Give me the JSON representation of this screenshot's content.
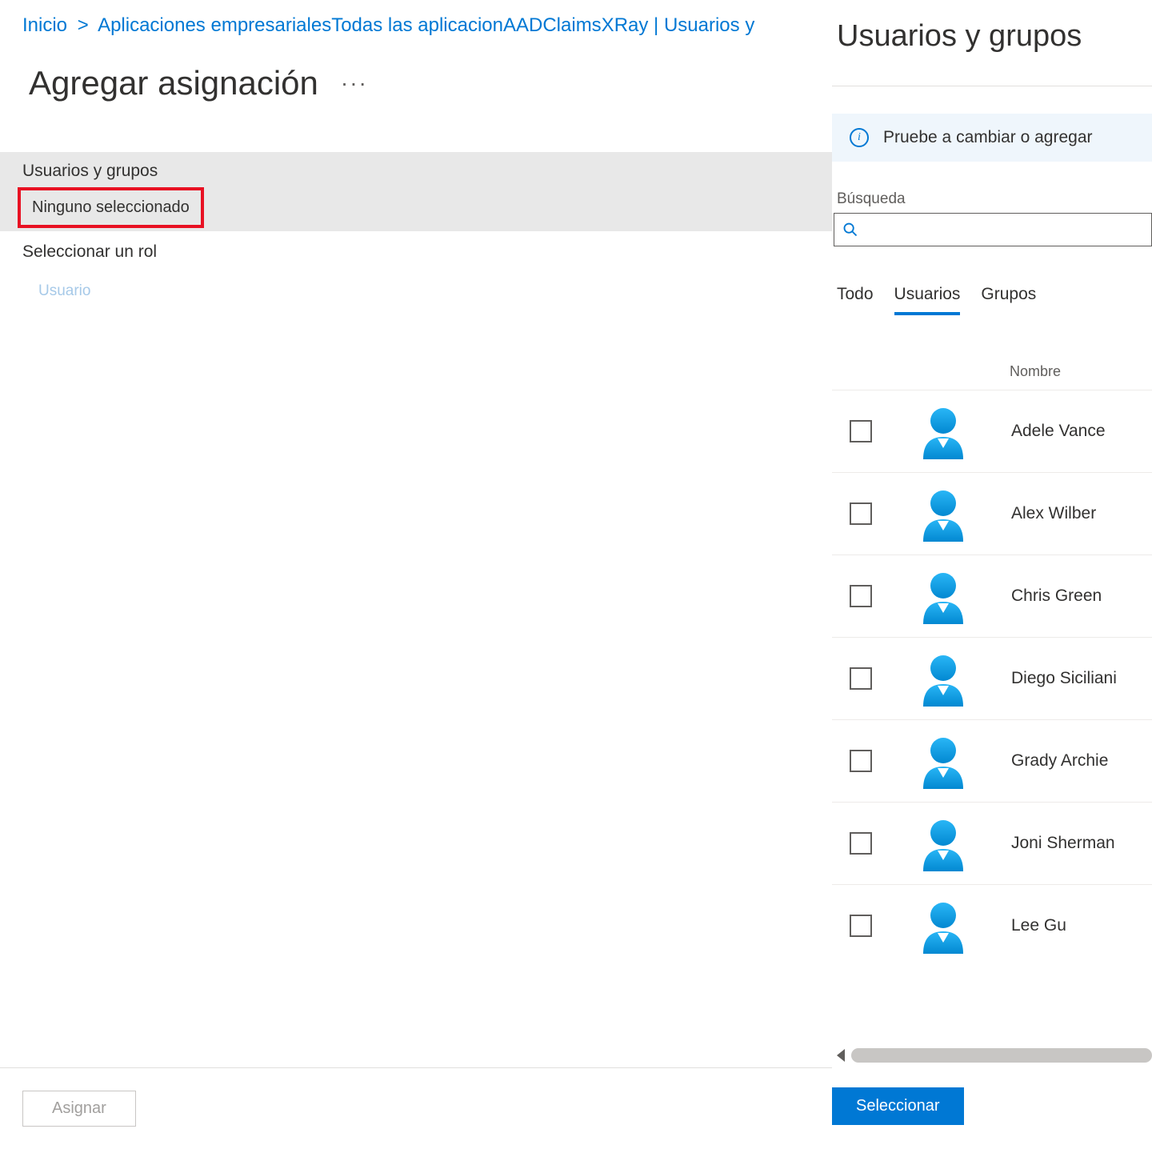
{
  "breadcrumb": {
    "home": "Inicio",
    "sep": ">",
    "item1": "Aplicaciones empresariales",
    "item2": "Todas las aplicacion",
    "item3": "AADClaimsXRay",
    "pipe": " | ",
    "item4": "Usuarios y"
  },
  "page_title": "Agregar asignación",
  "ellipsis": "···",
  "section_users": {
    "label": "Usuarios y grupos",
    "value": "Ninguno seleccionado"
  },
  "section_role": {
    "label": "Seleccionar un rol",
    "value": "Usuario"
  },
  "assign_button": "Asignar",
  "flyout": {
    "title": "Usuarios y grupos",
    "info_text": "Pruebe a cambiar o agregar ",
    "search_label": "Búsqueda",
    "search_placeholder": "",
    "tabs": [
      {
        "label": "Todo",
        "active": false
      },
      {
        "label": "Usuarios",
        "active": true
      },
      {
        "label": "Grupos",
        "active": false
      }
    ],
    "header_name": "Nombre",
    "users": [
      {
        "name": "Adele Vance"
      },
      {
        "name": "Alex Wilber"
      },
      {
        "name": "Chris Green"
      },
      {
        "name": "Diego Siciliani"
      },
      {
        "name": "Grady Archie"
      },
      {
        "name": "Joni Sherman"
      },
      {
        "name": "Lee Gu"
      }
    ],
    "select_button": "Seleccionar"
  },
  "colors": {
    "accent": "#0078d4",
    "avatar_top": "#29b6f6",
    "avatar_bottom": "#0288d1",
    "highlight_border": "#e81123"
  }
}
